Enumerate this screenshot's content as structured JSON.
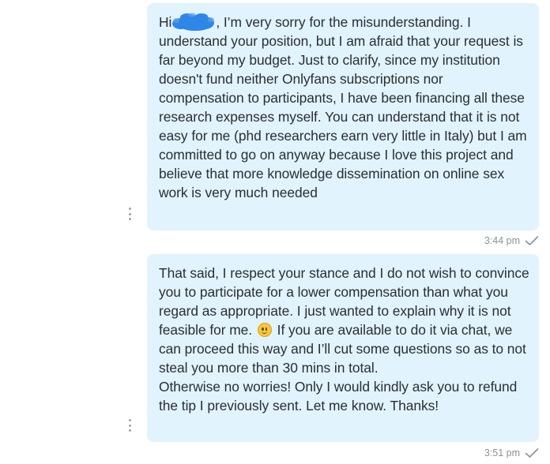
{
  "messages": [
    {
      "greeting": "Hi",
      "text_after_name": ", I’m very sorry for the misunderstanding. I understand your position, but I am afraid that your request is far beyond my budget. Just to clarify, since my institution doesn't fund neither Onlyfans subscriptions nor compensation to participants, I have been financing all these research expenses myself. You can understand that it is not easy for me (phd researchers earn very little in Italy) but I am committed to go on anyway because I love this project and believe that more knowledge dissemination on online sex work is very much needed",
      "time": "3:44 pm",
      "status_icon": "check-icon"
    },
    {
      "text_before_emoji": "That said, I respect your stance and I do not wish to convince you to participate for a lower compensation than what you regard as appropriate. I just wanted to explain why it is not feasible for me.",
      "emoji": "slightly-smiling-face",
      "text_after_emoji": " If you are available to do it via chat, we can proceed this way and I’ll cut some questions so as to not steal you more than 30 mins in total.",
      "text_line2": "Otherwise no worries! Only I would kindly ask you to refund the tip I previously sent. Let me know. Thanks!",
      "time": "3:51 pm",
      "status_icon": "check-icon"
    }
  ],
  "colors": {
    "bubble": "#e1f3fc",
    "text": "#2a2e33",
    "meta": "#8a9199",
    "redaction": "#2f86e6"
  }
}
